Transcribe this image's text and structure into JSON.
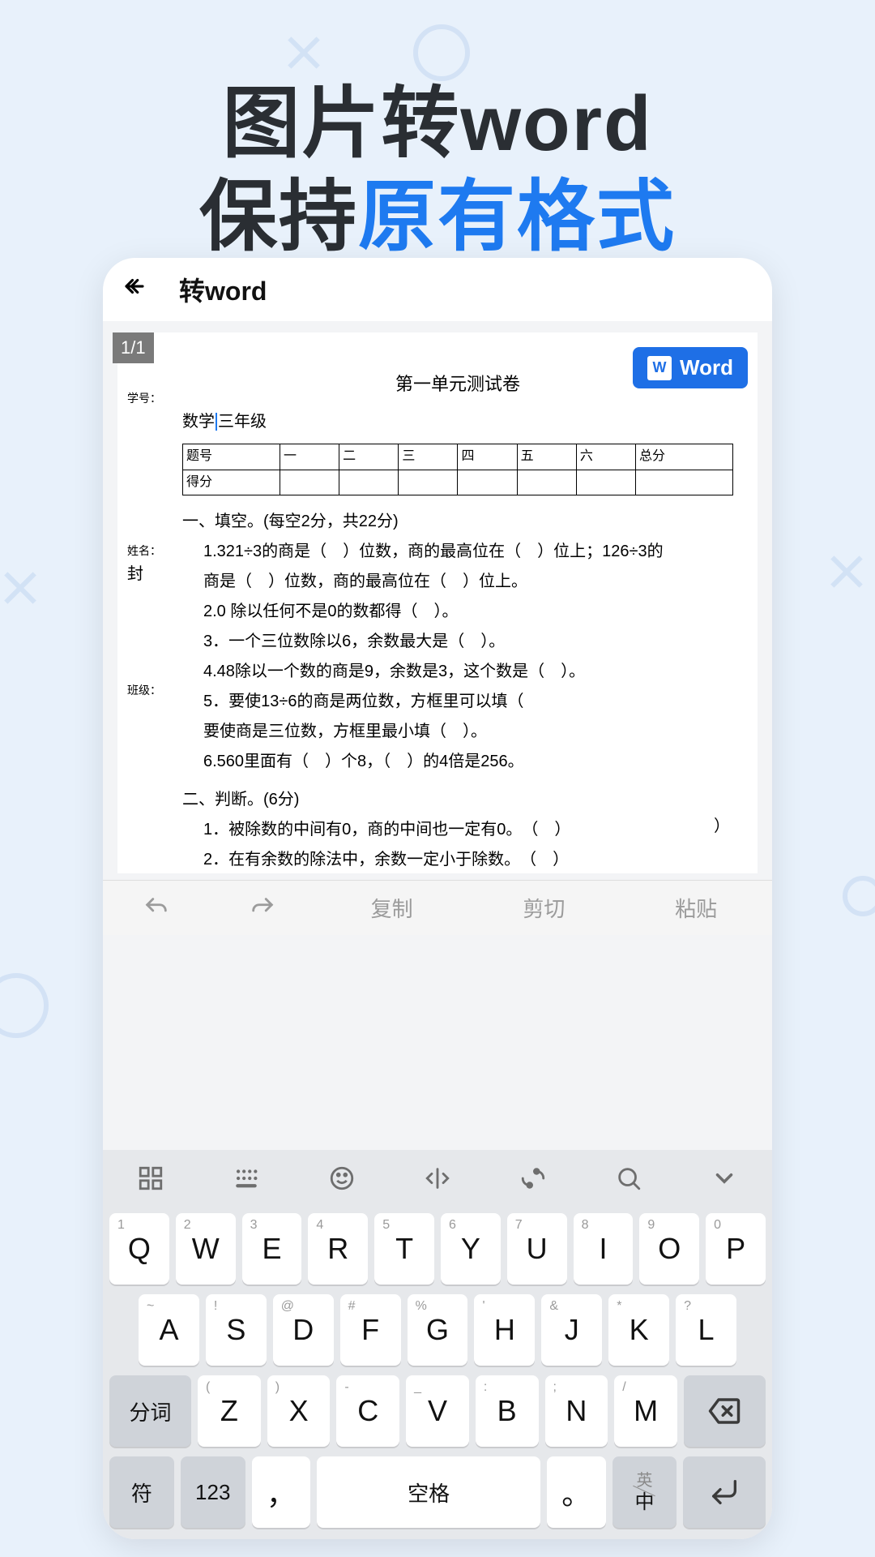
{
  "headline": {
    "line1": "图片转word",
    "line2_prefix": "保持",
    "line2_accent": "原有格式"
  },
  "app": {
    "title": "转word",
    "page_indicator": "1/1",
    "word_button": "Word"
  },
  "edit_bar": {
    "copy": "复制",
    "cut": "剪切",
    "paste": "粘贴"
  },
  "doc": {
    "title": "第一单元测试卷",
    "margin_labels": {
      "xuehao": "学号：",
      "xingming": "姓名：",
      "feng": "封",
      "banji": "班级："
    },
    "subject_prefix": "数学",
    "subject_grade": "三年级",
    "table_headers": [
      "题号",
      "一",
      "二",
      "三",
      "四",
      "五",
      "六",
      "总分"
    ],
    "table_row2_label": "得分",
    "section1_title": "一、填空。(每空2分，共22分)",
    "q1a": "1.321÷3的商是（　）位数，商的最高位在（　）位上；126÷3的",
    "q1b": "商是（　）位数，商的最高位在（　）位上。",
    "q2": "2.0 除以任何不是0的数都得（　）。",
    "q3": "3．一个三位数除以6，余数最大是（　）。",
    "q4": "4.48除以一个数的商是9，余数是3，这个数是（　）。",
    "q5a": "5．要使13÷6的商是两位数，方框里可以填（",
    "q5b": "要使商是三位数，方框里最小填（　）。",
    "q6": "6.560里面有（　）个8，（　）的4倍是256。",
    "section2_title": "二、判断。(6分)",
    "j1": "1．被除数的中间有0，商的中间也一定有0。　（　）",
    "j1_right": "）",
    "j2": "2．在有余数的除法中，余数一定小于除数。　（　）"
  },
  "keyboard": {
    "row1": [
      {
        "k": "Q",
        "s": "1"
      },
      {
        "k": "W",
        "s": "2"
      },
      {
        "k": "E",
        "s": "3"
      },
      {
        "k": "R",
        "s": "4"
      },
      {
        "k": "T",
        "s": "5"
      },
      {
        "k": "Y",
        "s": "6"
      },
      {
        "k": "U",
        "s": "7"
      },
      {
        "k": "I",
        "s": "8"
      },
      {
        "k": "O",
        "s": "9"
      },
      {
        "k": "P",
        "s": "0"
      }
    ],
    "row2": [
      {
        "k": "A",
        "s": "~"
      },
      {
        "k": "S",
        "s": "!"
      },
      {
        "k": "D",
        "s": "@"
      },
      {
        "k": "F",
        "s": "#"
      },
      {
        "k": "G",
        "s": "%"
      },
      {
        "k": "H",
        "s": "'"
      },
      {
        "k": "J",
        "s": "&"
      },
      {
        "k": "K",
        "s": "*"
      },
      {
        "k": "L",
        "s": "?"
      }
    ],
    "row3_fn": "分词",
    "row3": [
      {
        "k": "Z",
        "s": "("
      },
      {
        "k": "X",
        "s": ")"
      },
      {
        "k": "C",
        "s": "-"
      },
      {
        "k": "V",
        "s": "_"
      },
      {
        "k": "B",
        "s": ":"
      },
      {
        "k": "N",
        "s": ";"
      },
      {
        "k": "M",
        "s": "/"
      }
    ],
    "row4": {
      "sym": "符",
      "num": "123",
      "comma": "，",
      "space": "空格",
      "period": "。",
      "lang_top": "英",
      "lang_bot": "中"
    }
  }
}
